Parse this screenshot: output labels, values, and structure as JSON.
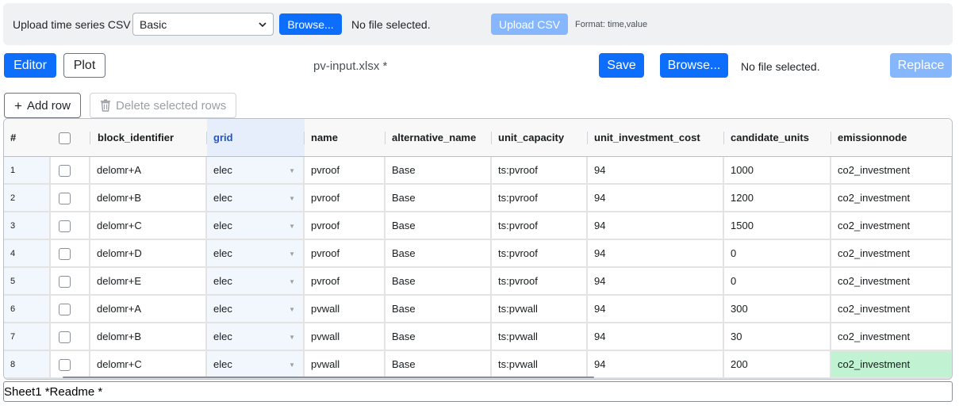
{
  "upload": {
    "label": "Upload time series CSV",
    "type_selected": "Basic",
    "browse_label": "Browse...",
    "file_status": "No file selected.",
    "upload_label": "Upload CSV",
    "format_hint": "Format: time,value"
  },
  "toolbar": {
    "editor_label": "Editor",
    "plot_label": "Plot",
    "filename": "pv-input.xlsx *",
    "save_label": "Save",
    "browse_label": "Browse...",
    "file_status": "No file selected.",
    "replace_label": "Replace",
    "add_row_label": "Add row",
    "delete_rows_label": "Delete selected rows"
  },
  "grid": {
    "columns": [
      "#",
      "",
      "block_identifier",
      "grid",
      "name",
      "alternative_name",
      "unit_capacity",
      "unit_investment_cost",
      "candidate_units",
      "emissionnode"
    ],
    "rows": [
      {
        "idx": "1",
        "block_identifier": "delomr+A",
        "grid": "elec",
        "name": "pvroof",
        "alternative_name": "Base",
        "unit_capacity": "ts:pvroof",
        "unit_investment_cost": "94",
        "candidate_units": "1000",
        "emissionnode": "co2_investment"
      },
      {
        "idx": "2",
        "block_identifier": "delomr+B",
        "grid": "elec",
        "name": "pvroof",
        "alternative_name": "Base",
        "unit_capacity": "ts:pvroof",
        "unit_investment_cost": "94",
        "candidate_units": "1200",
        "emissionnode": "co2_investment"
      },
      {
        "idx": "3",
        "block_identifier": "delomr+C",
        "grid": "elec",
        "name": "pvroof",
        "alternative_name": "Base",
        "unit_capacity": "ts:pvroof",
        "unit_investment_cost": "94",
        "candidate_units": "1500",
        "emissionnode": "co2_investment"
      },
      {
        "idx": "4",
        "block_identifier": "delomr+D",
        "grid": "elec",
        "name": "pvroof",
        "alternative_name": "Base",
        "unit_capacity": "ts:pvroof",
        "unit_investment_cost": "94",
        "candidate_units": "0",
        "emissionnode": "co2_investment"
      },
      {
        "idx": "5",
        "block_identifier": "delomr+E",
        "grid": "elec",
        "name": "pvroof",
        "alternative_name": "Base",
        "unit_capacity": "ts:pvroof",
        "unit_investment_cost": "94",
        "candidate_units": "0",
        "emissionnode": "co2_investment"
      },
      {
        "idx": "6",
        "block_identifier": "delomr+A",
        "grid": "elec",
        "name": "pvwall",
        "alternative_name": "Base",
        "unit_capacity": "ts:pvwall",
        "unit_investment_cost": "94",
        "candidate_units": "300",
        "emissionnode": "co2_investment"
      },
      {
        "idx": "7",
        "block_identifier": "delomr+B",
        "grid": "elec",
        "name": "pvwall",
        "alternative_name": "Base",
        "unit_capacity": "ts:pvwall",
        "unit_investment_cost": "94",
        "candidate_units": "30",
        "emissionnode": "co2_investment"
      },
      {
        "idx": "8",
        "block_identifier": "delomr+C",
        "grid": "elec",
        "name": "pvwall",
        "alternative_name": "Base",
        "unit_capacity": "ts:pvwall",
        "unit_investment_cost": "94",
        "candidate_units": "200",
        "emissionnode": "co2_investment"
      }
    ]
  },
  "sheets": {
    "tabs_text": "Sheet1 *Readme *"
  },
  "icons": {
    "select_chevron": "chevron-down-icon",
    "trash": "trash-icon",
    "plus": "plus-icon",
    "dropdown": "caret-down-icon"
  },
  "colors": {
    "primary": "#0d6efd",
    "primary_disabled": "#86b7fe",
    "selected_column": "#e6eefc",
    "highlight_cell": "#c1f2d1"
  }
}
